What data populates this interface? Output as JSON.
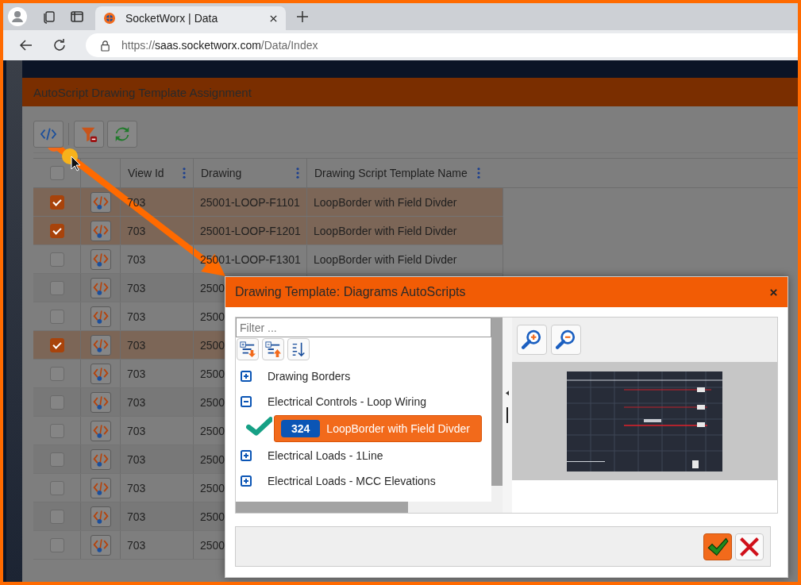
{
  "browser": {
    "tab_title": "SocketWorx | Data",
    "url_scheme": "https://",
    "url_host": "saas.socketworx.com",
    "url_path": "/Data/Index"
  },
  "assignment_window": {
    "title": "AutoScript Drawing Template Assignment",
    "table": {
      "select_all_checked": false,
      "columns": [
        "View Id",
        "Drawing",
        "Drawing Script Template Name"
      ],
      "rows": [
        {
          "checked": true,
          "view_id": "703",
          "drawing": "25001-LOOP-F1101",
          "template": "LoopBorder with Field Divder"
        },
        {
          "checked": true,
          "view_id": "703",
          "drawing": "25001-LOOP-F1201",
          "template": "LoopBorder with Field Divder"
        },
        {
          "checked": false,
          "view_id": "703",
          "drawing": "25001-LOOP-F1301",
          "template": "LoopBorder with Field Divder"
        },
        {
          "checked": false,
          "view_id": "703",
          "drawing": "2500"
        },
        {
          "checked": false,
          "view_id": "703",
          "drawing": "2500"
        },
        {
          "checked": true,
          "view_id": "703",
          "drawing": "2500"
        },
        {
          "checked": false,
          "view_id": "703",
          "drawing": "2500"
        },
        {
          "checked": false,
          "view_id": "703",
          "drawing": "2500"
        },
        {
          "checked": false,
          "view_id": "703",
          "drawing": "2500"
        },
        {
          "checked": false,
          "view_id": "703",
          "drawing": "2500"
        },
        {
          "checked": false,
          "view_id": "703",
          "drawing": "2500"
        },
        {
          "checked": false,
          "view_id": "703",
          "drawing": "2500"
        },
        {
          "checked": false,
          "view_id": "703",
          "drawing": "2500"
        }
      ]
    }
  },
  "dialog": {
    "title": "Drawing Template: Diagrams AutoScripts",
    "filter": {
      "placeholder": "Filter ..."
    },
    "tree": [
      {
        "label": "Drawing Borders",
        "expanded": false
      },
      {
        "label": "Electrical Controls - Loop Wiring",
        "expanded": true,
        "children": [
          {
            "id": "324",
            "label": "LoopBorder with Field Divder",
            "selected": true
          }
        ]
      },
      {
        "label": "Electrical Loads - 1Line",
        "expanded": false
      },
      {
        "label": "Electrical Loads - MCC Elevations",
        "expanded": false
      }
    ]
  }
}
